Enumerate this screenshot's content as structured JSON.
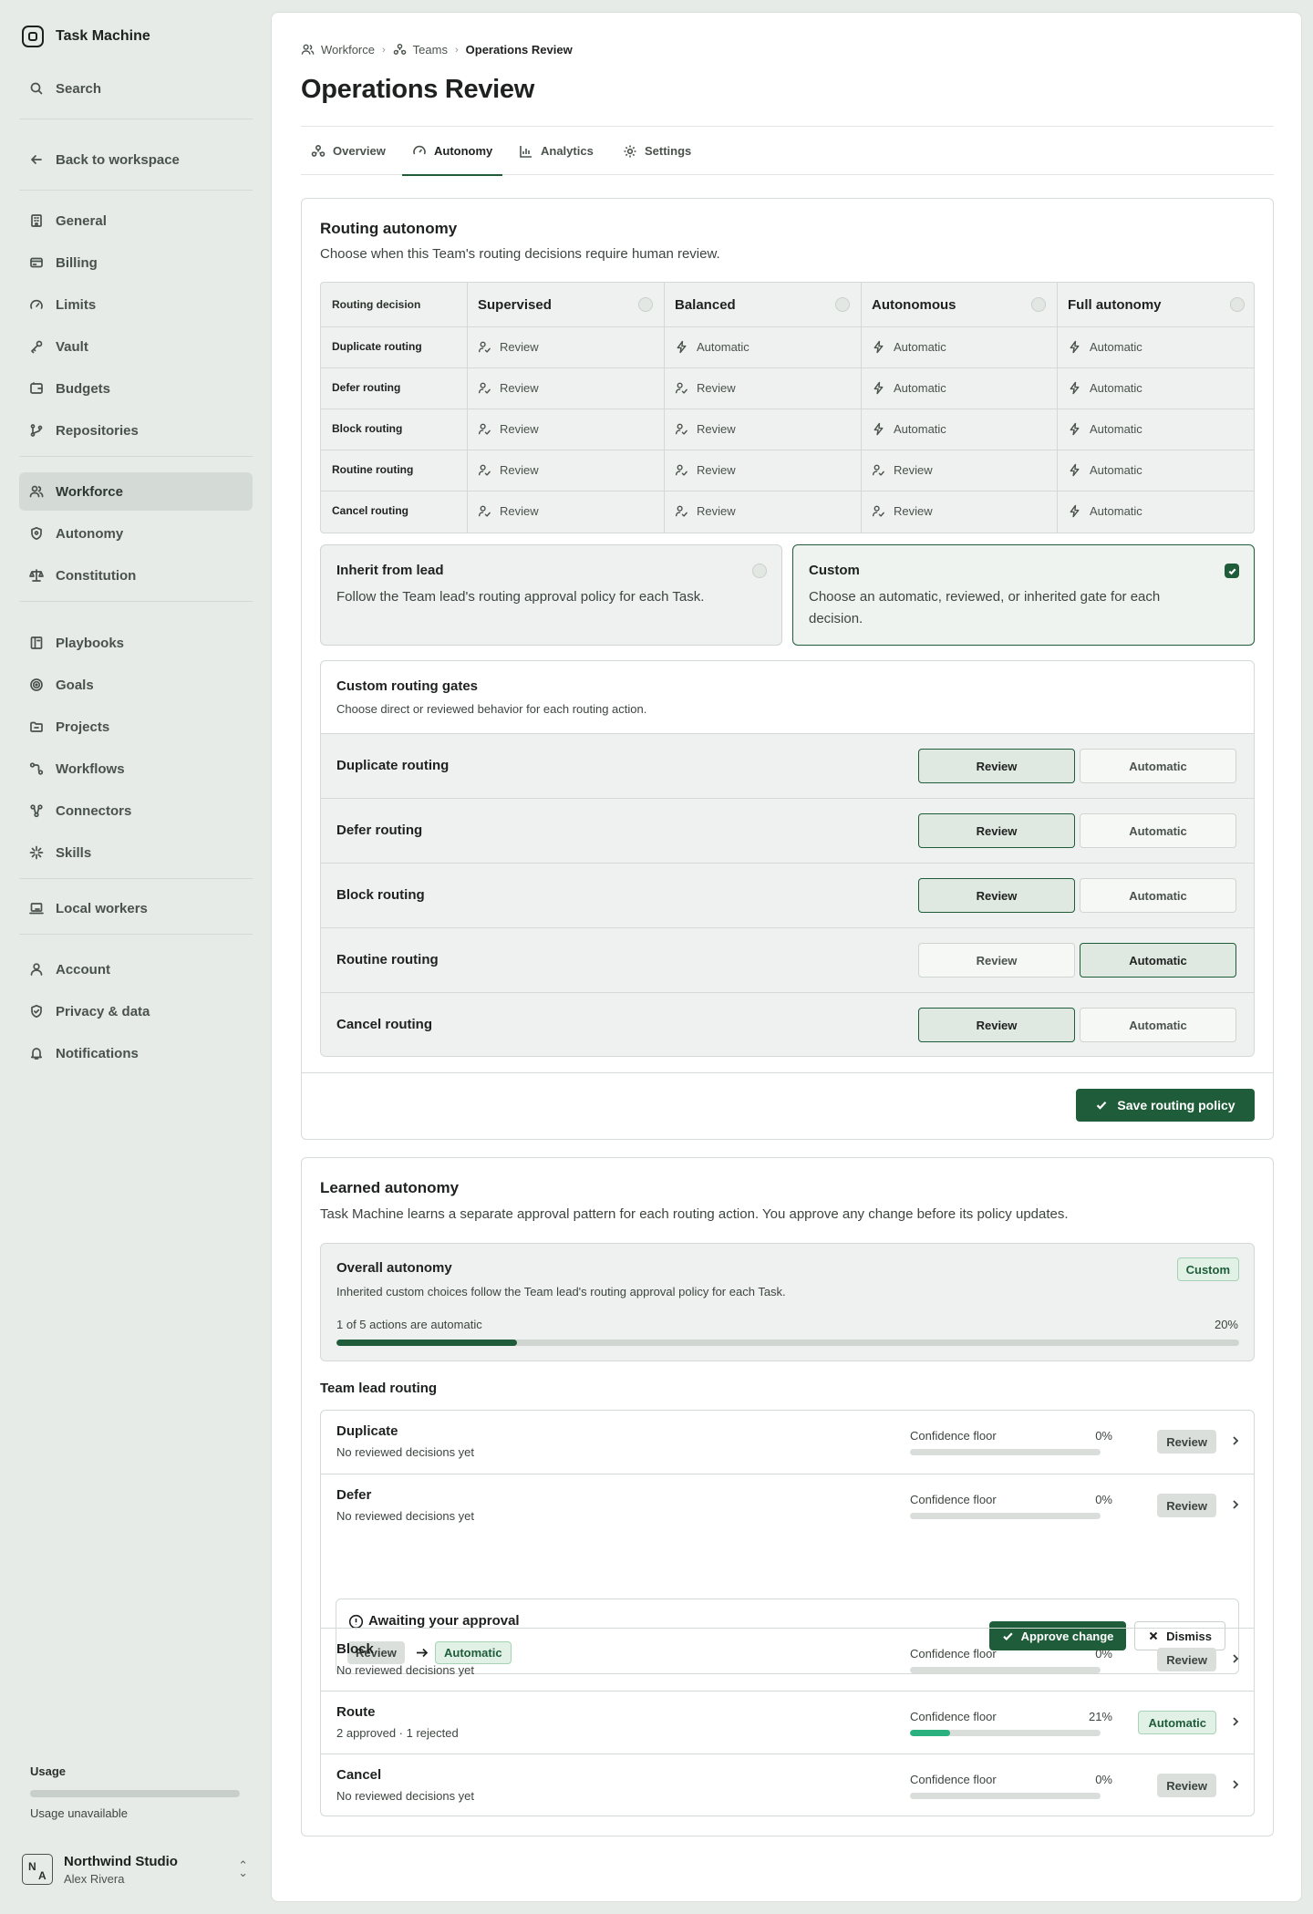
{
  "app": {
    "name": "Task Machine"
  },
  "sidebar": {
    "search_label": "Search",
    "back_label": "Back to workspace",
    "groups": [
      [
        {
          "label": "General",
          "icon": "building-icon"
        },
        {
          "label": "Billing",
          "icon": "credit-card-icon"
        },
        {
          "label": "Limits",
          "icon": "gauge-icon"
        },
        {
          "label": "Vault",
          "icon": "key-icon"
        },
        {
          "label": "Budgets",
          "icon": "wallet-icon"
        },
        {
          "label": "Repositories",
          "icon": "git-branch-icon"
        }
      ],
      [
        {
          "label": "Workforce",
          "icon": "users-icon",
          "active": true
        },
        {
          "label": "Autonomy",
          "icon": "shield-icon"
        },
        {
          "label": "Constitution",
          "icon": "scale-icon"
        }
      ],
      [
        {
          "label": "Playbooks",
          "icon": "book-icon"
        },
        {
          "label": "Goals",
          "icon": "target-icon"
        },
        {
          "label": "Projects",
          "icon": "folder-icon"
        },
        {
          "label": "Workflows",
          "icon": "workflow-icon"
        },
        {
          "label": "Connectors",
          "icon": "link-icon"
        },
        {
          "label": "Skills",
          "icon": "sparkle-icon"
        }
      ],
      [
        {
          "label": "Local workers",
          "icon": "laptop-icon"
        }
      ],
      [
        {
          "label": "Account",
          "icon": "user-icon"
        },
        {
          "label": "Privacy & data",
          "icon": "shield-check-icon"
        },
        {
          "label": "Notifications",
          "icon": "bell-icon"
        }
      ]
    ],
    "usage": {
      "title": "Usage",
      "text": "Usage unavailable"
    },
    "account": {
      "org": "Northwind Studio",
      "user": "Alex Rivera",
      "initials_1": "N",
      "initials_2": "A"
    }
  },
  "breadcrumb": [
    {
      "label": "Workforce",
      "icon": "users-icon"
    },
    {
      "label": "Teams",
      "icon": "team-icon"
    },
    {
      "label": "Operations Review",
      "current": true
    }
  ],
  "page": {
    "title": "Operations Review"
  },
  "tabs": [
    {
      "label": "Overview",
      "icon": "team-icon"
    },
    {
      "label": "Autonomy",
      "icon": "gauge-icon",
      "active": true
    },
    {
      "label": "Analytics",
      "icon": "bar-chart-icon"
    },
    {
      "label": "Settings",
      "icon": "gear-icon"
    }
  ],
  "routing": {
    "title": "Routing autonomy",
    "subtitle": "Choose when this Team's routing decisions require human review.",
    "table": {
      "corner": "Routing decision",
      "columns": [
        "Supervised",
        "Balanced",
        "Autonomous",
        "Full autonomy"
      ],
      "rows": [
        {
          "label": "Duplicate routing",
          "cells": [
            "Review",
            "Automatic",
            "Automatic",
            "Automatic"
          ]
        },
        {
          "label": "Defer routing",
          "cells": [
            "Review",
            "Review",
            "Automatic",
            "Automatic"
          ]
        },
        {
          "label": "Block routing",
          "cells": [
            "Review",
            "Review",
            "Automatic",
            "Automatic"
          ]
        },
        {
          "label": "Routine routing",
          "cells": [
            "Review",
            "Review",
            "Review",
            "Automatic"
          ]
        },
        {
          "label": "Cancel routing",
          "cells": [
            "Review",
            "Review",
            "Review",
            "Automatic"
          ]
        }
      ]
    },
    "options": [
      {
        "title": "Inherit from lead",
        "desc": "Follow the Team lead's routing approval policy for each Task.",
        "selected": false
      },
      {
        "title": "Custom",
        "desc": "Choose an automatic, reviewed, or inherited gate for each decision.",
        "selected": true
      }
    ],
    "gates": {
      "title": "Custom routing gates",
      "subtitle": "Choose direct or reviewed behavior for each routing action.",
      "review_label": "Review",
      "automatic_label": "Automatic",
      "rows": [
        {
          "label": "Duplicate routing",
          "value": "Review"
        },
        {
          "label": "Defer routing",
          "value": "Review"
        },
        {
          "label": "Block routing",
          "value": "Review"
        },
        {
          "label": "Routine routing",
          "value": "Automatic"
        },
        {
          "label": "Cancel routing",
          "value": "Review"
        }
      ]
    },
    "save_label": "Save routing policy"
  },
  "learned": {
    "title": "Learned autonomy",
    "subtitle": "Task Machine learns a separate approval pattern for each routing action. You approve any change before its policy updates.",
    "overall": {
      "title": "Overall autonomy",
      "badge": "Custom",
      "subtitle": "Inherited custom choices follow the Team lead's routing approval policy for each Task.",
      "count_text": "1 of 5 actions are automatic",
      "percent_text": "20%",
      "fraction": 0.2
    },
    "team_lead_title": "Team lead routing",
    "confidence_label": "Confidence floor",
    "rows": [
      {
        "name": "Duplicate",
        "desc": "No reviewed decisions yet",
        "pct": "0%",
        "fraction": 0,
        "status": "Review"
      },
      {
        "name": "Defer",
        "desc": "No reviewed decisions yet",
        "pct": "0%",
        "fraction": 0,
        "status": "Review"
      },
      {
        "name": "Block",
        "desc": "No reviewed decisions yet",
        "pct": "0%",
        "fraction": 0,
        "status": "Review"
      },
      {
        "name": "Route",
        "desc": "2 approved · 1 rejected",
        "pct": "21%",
        "fraction": 0.21,
        "status": "Automatic"
      },
      {
        "name": "Cancel",
        "desc": "No reviewed decisions yet",
        "pct": "0%",
        "fraction": 0,
        "status": "Review"
      }
    ],
    "approval": {
      "title": "Awaiting your approval",
      "from": "Review",
      "to": "Automatic",
      "approve_label": "Approve change",
      "dismiss_label": "Dismiss"
    }
  }
}
